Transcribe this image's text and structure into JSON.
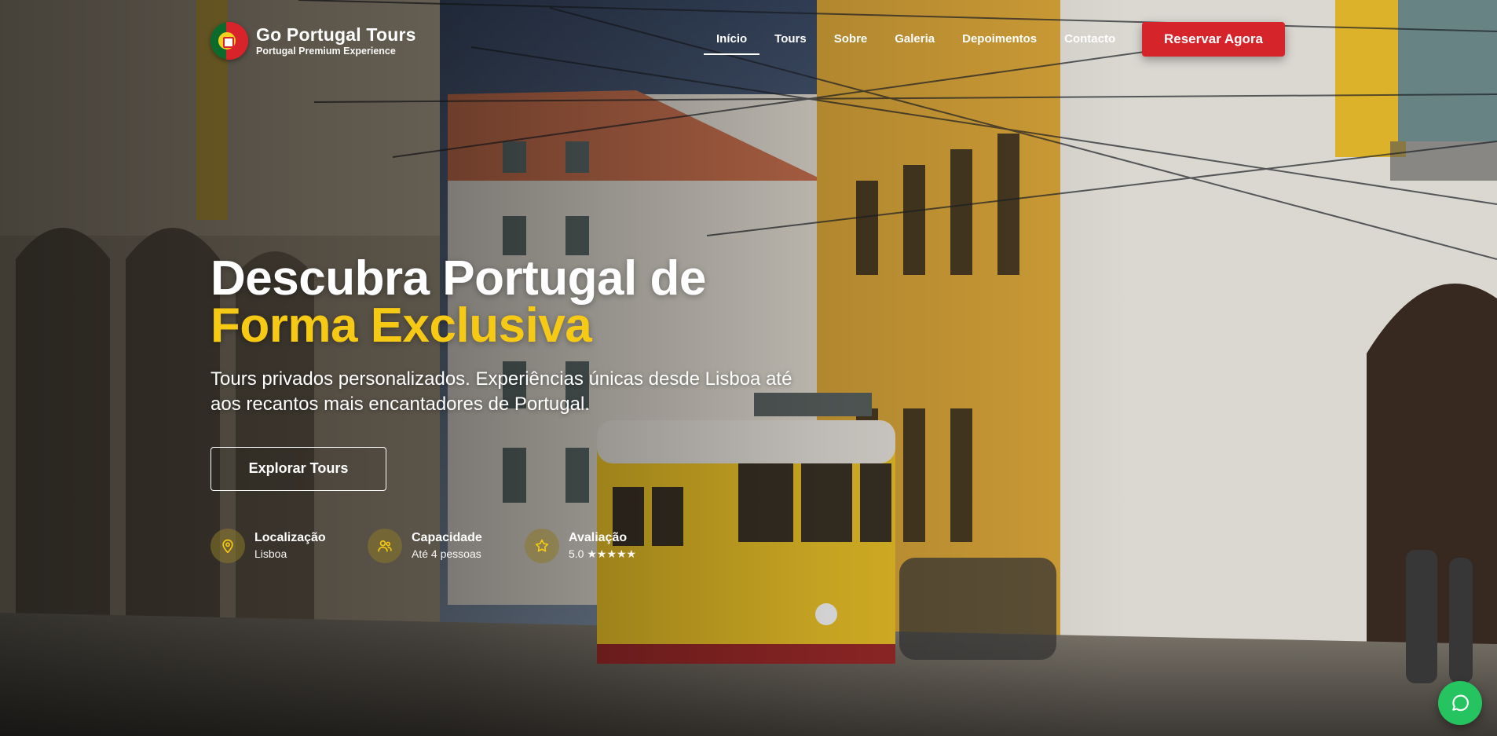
{
  "brand": {
    "name": "Go Portugal Tours",
    "tagline": "Portugal Premium Experience"
  },
  "nav": {
    "items": [
      "Início",
      "Tours",
      "Sobre",
      "Galeria",
      "Depoimentos",
      "Contacto"
    ],
    "active": "Início",
    "cta_label": "Reservar Agora"
  },
  "hero": {
    "title_line1": "Descubra Portugal de",
    "title_line2": "Forma Exclusiva",
    "subtitle": "Tours privados personalizados. Experiências únicas desde Lisboa até aos recantos mais encantadores de Portugal.",
    "button_label": "Explorar Tours"
  },
  "features": [
    {
      "icon": "location-pin-icon",
      "title": "Localização",
      "value": "Lisboa"
    },
    {
      "icon": "users-icon",
      "title": "Capacidade",
      "value": "Até 4 pessoas"
    },
    {
      "icon": "star-icon",
      "title": "Avaliação",
      "value": "5.0 ★★★★★"
    }
  ],
  "colors": {
    "accent_yellow": "#f6c915",
    "cta_red": "#d6242b",
    "whatsapp_green": "#25c460"
  },
  "floating": {
    "icon": "whatsapp-chat-icon"
  }
}
